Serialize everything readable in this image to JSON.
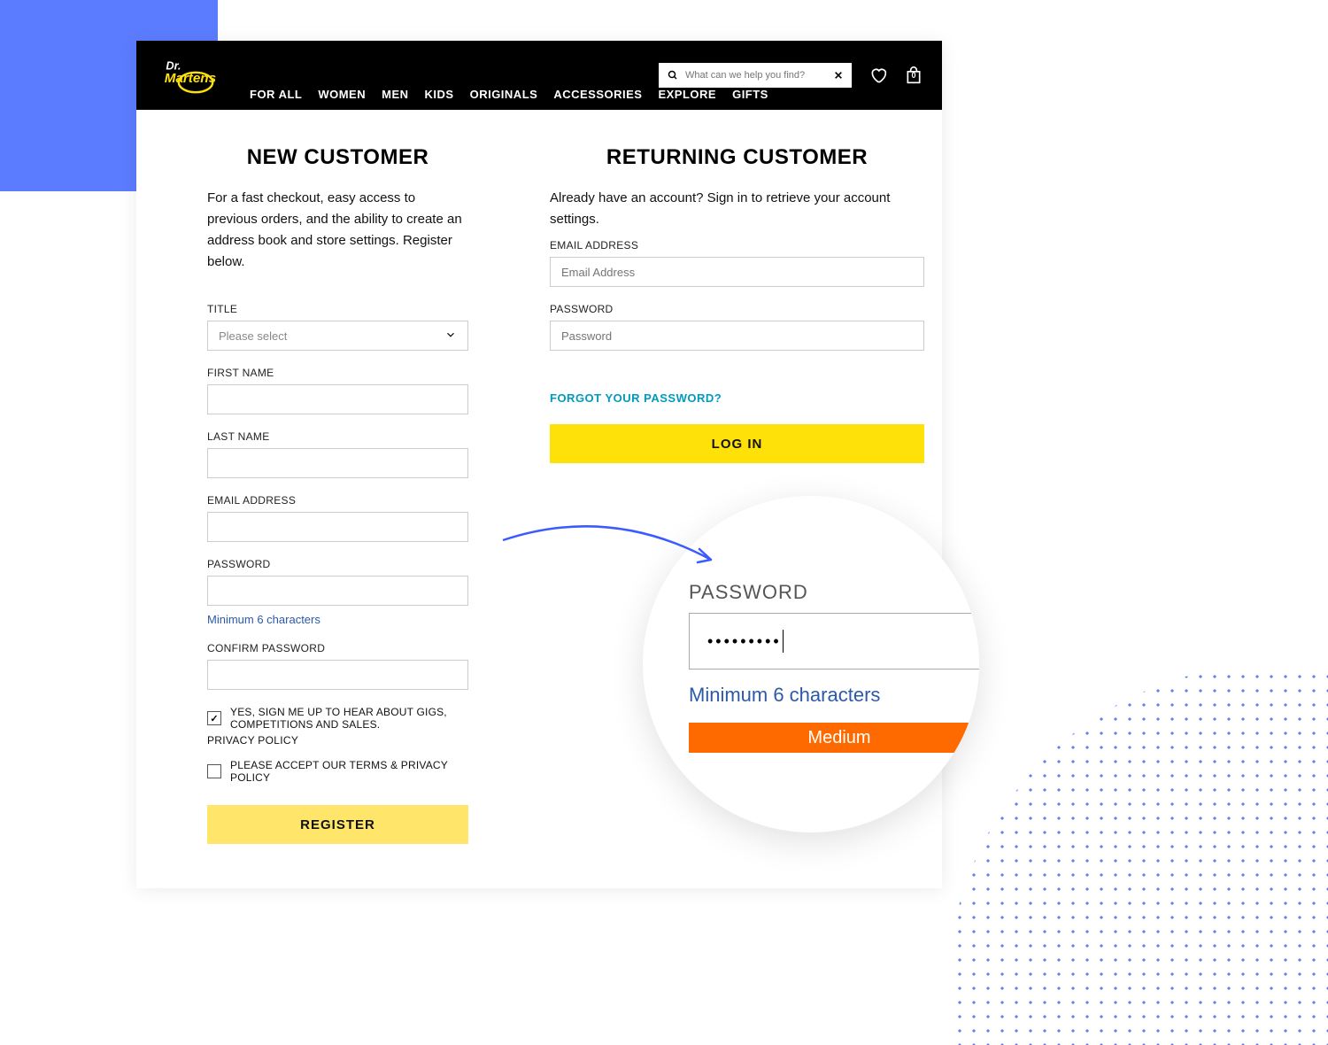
{
  "header": {
    "search_placeholder": "What can we help you find?",
    "bag_count": "0",
    "nav": [
      "FOR ALL",
      "WOMEN",
      "MEN",
      "KIDS",
      "ORIGINALS",
      "ACCESSORIES",
      "EXPLORE",
      "GIFTS"
    ]
  },
  "new_customer": {
    "heading": "NEW CUSTOMER",
    "intro": "For a fast checkout, easy access to previous orders, and the ability to create an address book and store settings. Register below.",
    "title_label": "TITLE",
    "title_placeholder": "Please select",
    "first_name_label": "FIRST NAME",
    "last_name_label": "LAST NAME",
    "email_label": "EMAIL ADDRESS",
    "password_label": "PASSWORD",
    "password_hint": "Minimum 6 characters",
    "confirm_password_label": "CONFIRM PASSWORD",
    "opt_in_label": "YES, SIGN ME UP TO HEAR ABOUT GIGS, COMPETITIONS AND SALES.",
    "privacy_policy": "PRIVACY POLICY",
    "accept_terms_label": "PLEASE ACCEPT OUR TERMS & PRIVACY POLICY",
    "register_button": "REGISTER"
  },
  "returning": {
    "heading": "RETURNING CUSTOMER",
    "intro": "Already have an account? Sign in to retrieve your account settings.",
    "email_label": "EMAIL ADDRESS",
    "email_placeholder": "Email Address",
    "password_label": "PASSWORD",
    "password_placeholder": "Password",
    "forgot": "FORGOT YOUR PASSWORD?",
    "login_button": "LOG IN"
  },
  "zoom": {
    "label": "PASSWORD",
    "masked": "•••••••••",
    "hint": "Minimum 6 characters",
    "strength": "Medium"
  }
}
